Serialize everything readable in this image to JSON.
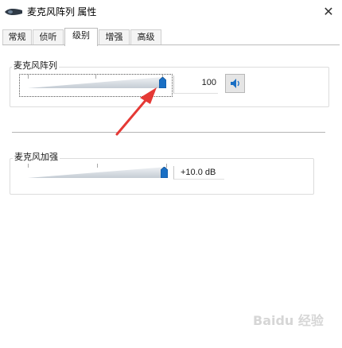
{
  "window": {
    "title": "麦克风阵列 属性",
    "close_glyph": "✕"
  },
  "tabs": [
    {
      "label": "常规",
      "active": false
    },
    {
      "label": "侦听",
      "active": false
    },
    {
      "label": "级别",
      "active": true
    },
    {
      "label": "增强",
      "active": false
    },
    {
      "label": "高级",
      "active": false
    }
  ],
  "mic_array": {
    "label": "麦克风阵列",
    "value": "100",
    "level_fraction": 1.0,
    "mute_icon": "speaker-icon"
  },
  "mic_boost": {
    "label": "麦克风加强",
    "value": "+10.0 dB",
    "level_fraction": 1.0
  },
  "annotation": {
    "arrow_color": "#e53935"
  },
  "watermark": {
    "text": "Baidu 经验"
  },
  "colors": {
    "accent": "#1a6fc4",
    "arrow": "#e53935"
  }
}
